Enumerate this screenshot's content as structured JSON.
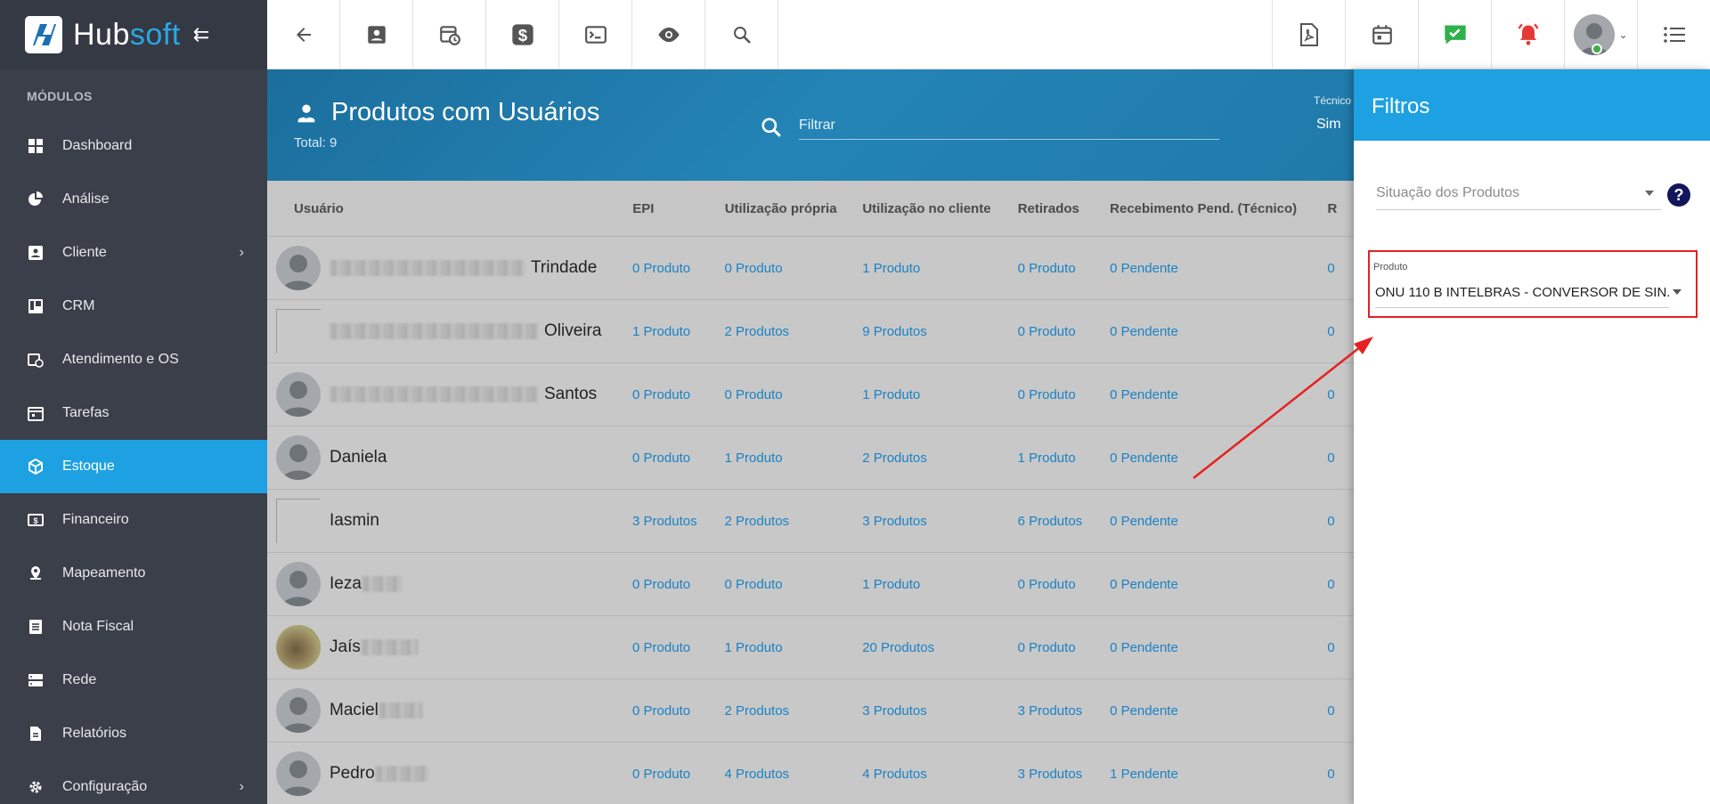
{
  "brand": {
    "name_a": "Hub",
    "name_b": "soft"
  },
  "sidebar": {
    "section_label": "MÓDULOS",
    "items": [
      {
        "label": "Dashboard",
        "icon": "dashboard-icon"
      },
      {
        "label": "Análise",
        "icon": "pie-chart-icon"
      },
      {
        "label": "Cliente",
        "icon": "contact-card-icon",
        "has_submenu": true
      },
      {
        "label": "CRM",
        "icon": "kanban-icon"
      },
      {
        "label": "Atendimento e OS",
        "icon": "calendar-clock-icon"
      },
      {
        "label": "Tarefas",
        "icon": "tasks-icon"
      },
      {
        "label": "Estoque",
        "icon": "box-icon",
        "active": true
      },
      {
        "label": "Financeiro",
        "icon": "money-icon"
      },
      {
        "label": "Mapeamento",
        "icon": "map-pin-icon"
      },
      {
        "label": "Nota Fiscal",
        "icon": "invoice-icon"
      },
      {
        "label": "Rede",
        "icon": "server-icon"
      },
      {
        "label": "Relatórios",
        "icon": "report-icon"
      },
      {
        "label": "Configuração",
        "icon": "gear-icon",
        "has_submenu": true
      }
    ]
  },
  "header": {
    "title": "Produtos com Usuários",
    "total": "Total: 9",
    "filter_placeholder": "Filtrar",
    "tecnico_label": "Técnico",
    "tecnico_value": "Sim"
  },
  "table": {
    "columns": [
      "Usuário",
      "EPI",
      "Utilização própria",
      "Utilização no cliente",
      "Retirados",
      "Recebimento Pend. (Técnico)",
      "R"
    ],
    "rows": [
      {
        "name": "Trindade",
        "epi": "0 Produto",
        "propria": "0 Produto",
        "cliente": "1 Produto",
        "retirados": "0 Produto",
        "receb": "0 Pendente",
        "extra": "0"
      },
      {
        "name": "Oliveira",
        "epi": "1 Produto",
        "propria": "2 Produtos",
        "cliente": "9 Produtos",
        "retirados": "0 Produto",
        "receb": "0 Pendente",
        "extra": "0"
      },
      {
        "name": "Santos",
        "epi": "0 Produto",
        "propria": "0 Produto",
        "cliente": "1 Produto",
        "retirados": "0 Produto",
        "receb": "0 Pendente",
        "extra": "0"
      },
      {
        "name": "Daniela",
        "epi": "0 Produto",
        "propria": "1 Produto",
        "cliente": "2 Produtos",
        "retirados": "1 Produto",
        "receb": "0 Pendente",
        "extra": "0"
      },
      {
        "name": "Iasmin",
        "epi": "3 Produtos",
        "propria": "2 Produtos",
        "cliente": "3 Produtos",
        "retirados": "6 Produtos",
        "receb": "0 Pendente",
        "extra": "0"
      },
      {
        "name": "Ieza",
        "epi": "0 Produto",
        "propria": "0 Produto",
        "cliente": "1 Produto",
        "retirados": "0 Produto",
        "receb": "0 Pendente",
        "extra": "0"
      },
      {
        "name": "Jaís",
        "epi": "0 Produto",
        "propria": "1 Produto",
        "cliente": "20 Produtos",
        "retirados": "0 Produto",
        "receb": "0 Pendente",
        "extra": "0"
      },
      {
        "name": "Maciel",
        "epi": "0 Produto",
        "propria": "2 Produtos",
        "cliente": "3 Produtos",
        "retirados": "3 Produtos",
        "receb": "0 Pendente",
        "extra": "0"
      },
      {
        "name": "Pedro",
        "epi": "0 Produto",
        "propria": "4 Produtos",
        "cliente": "4 Produtos",
        "retirados": "3 Produtos",
        "receb": "1 Pendente",
        "extra": "0"
      }
    ]
  },
  "filters": {
    "title": "Filtros",
    "situacao_placeholder": "Situação dos Produtos",
    "help": "?",
    "produto_label": "Produto",
    "produto_value": "ONU 110 B INTELBRAS - CONVERSOR DE SIN..."
  },
  "colors": {
    "accent": "#1da1e2",
    "sidebar": "#3b3f4a",
    "link": "#1a82c4",
    "highlight": "#e52121"
  }
}
